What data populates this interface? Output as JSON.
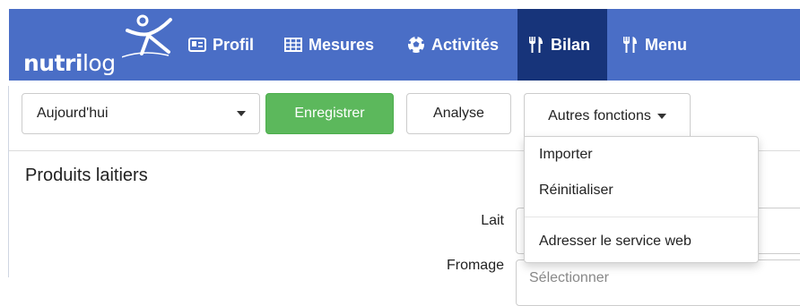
{
  "brand": {
    "name_bold": "nutri",
    "name_light": "log"
  },
  "nav": {
    "items": [
      {
        "label": "Profil",
        "icon": "id-card-icon",
        "active": false
      },
      {
        "label": "Mesures",
        "icon": "table-grid-icon",
        "active": false
      },
      {
        "label": "Activités",
        "icon": "soccer-ball-icon",
        "active": false
      },
      {
        "label": "Bilan",
        "icon": "fork-knife-icon",
        "active": true
      },
      {
        "label": "Menu",
        "icon": "fork-knife-icon",
        "active": false
      }
    ],
    "background_color": "#4a6ec6",
    "active_color": "#17347a"
  },
  "toolbar": {
    "date_select_value": "Aujourd'hui",
    "save_label": "Enregistrer",
    "analyse_label": "Analyse",
    "more_label": "Autres fonctions",
    "save_color": "#5cb85c"
  },
  "dropdown": {
    "items": [
      "Importer",
      "Réinitialiser",
      "Adresser le service web"
    ]
  },
  "content": {
    "section_title": "Produits laitiers",
    "fields": [
      {
        "label": "Lait",
        "value": ""
      },
      {
        "label": "Fromage",
        "placeholder": "Sélectionner"
      }
    ]
  }
}
